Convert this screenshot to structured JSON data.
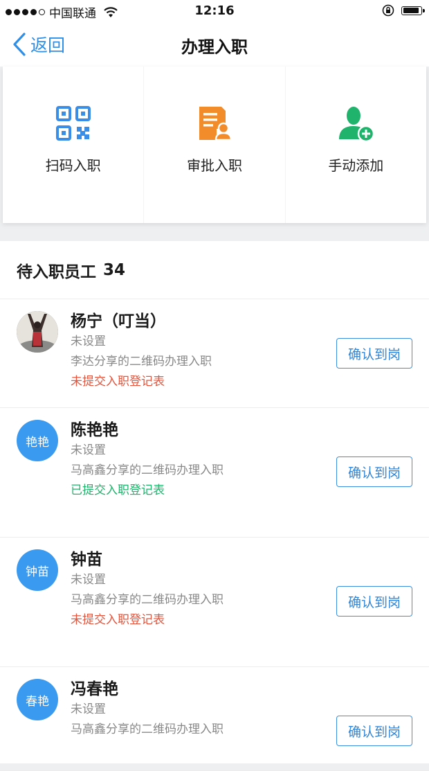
{
  "status_bar": {
    "carrier": "中国联通",
    "time": "12:16"
  },
  "nav": {
    "back_label": "返回",
    "title": "办理入职"
  },
  "actions": [
    {
      "label": "扫码入职",
      "icon": "qr-code-icon",
      "color": "#3a8ee6"
    },
    {
      "label": "审批入职",
      "icon": "approval-document-icon",
      "color": "#f28b2a"
    },
    {
      "label": "手动添加",
      "icon": "add-user-icon",
      "color": "#20b36b"
    }
  ],
  "pending": {
    "label": "待入职员工",
    "count": "34",
    "confirm_label": "确认到岗",
    "employees": [
      {
        "name": "杨宁（叮当）",
        "avatar_text": "",
        "subtitle": "未设置",
        "source": "李达分享的二维码办理入职",
        "status": "未提交入职登记表",
        "status_color": "#e2553e"
      },
      {
        "name": "陈艳艳",
        "avatar_text": "艳艳",
        "subtitle": "未设置",
        "source": "马高鑫分享的二维码办理入职",
        "status": "已提交入职登记表",
        "status_color": "#20b36b"
      },
      {
        "name": "钟苗",
        "avatar_text": "钟苗",
        "subtitle": "未设置",
        "source": "马高鑫分享的二维码办理入职",
        "status": "未提交入职登记表",
        "status_color": "#e2553e"
      },
      {
        "name": "冯春艳",
        "avatar_text": "春艳",
        "subtitle": "未设置",
        "source": "马高鑫分享的二维码办理入职",
        "status": "",
        "status_color": "#e2553e"
      }
    ]
  },
  "colors": {
    "accent": "#2f8ee5",
    "avatar_bg": "#3a9af0"
  }
}
